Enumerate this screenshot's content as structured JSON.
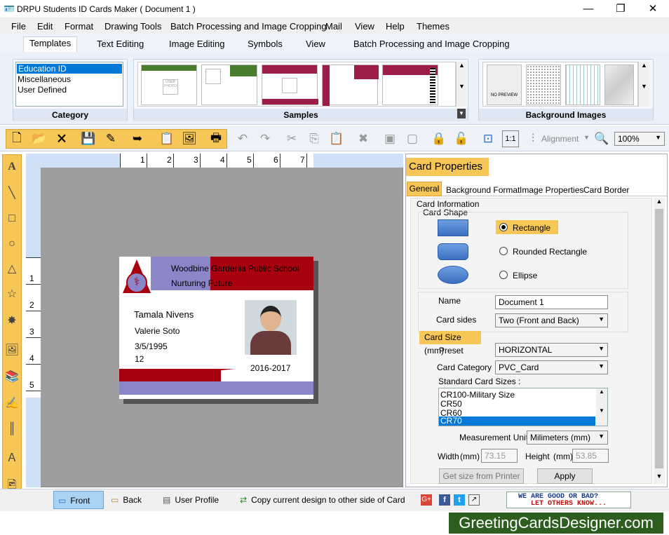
{
  "window": {
    "title": "DRPU Students ID Cards Maker ( Document 1 )"
  },
  "menu": [
    "File",
    "Edit",
    "Format",
    "Drawing Tools",
    "Batch Processing and Image Cropping",
    "Mail",
    "View",
    "Help",
    "Themes"
  ],
  "ribbon_tabs": [
    "Templates",
    "Text Editing",
    "Image Editing",
    "Symbols",
    "View",
    "Batch Processing and Image Cropping"
  ],
  "category": {
    "label": "Category",
    "items": [
      "Education ID",
      "Miscellaneous",
      "User Defined"
    ],
    "selected": "Education ID"
  },
  "samples": {
    "label": "Samples"
  },
  "backgrounds": {
    "label": "Background Images",
    "no_preview": "NO PREVIEW"
  },
  "toolbar": {
    "alignment": "Alignment",
    "zoom": "100%"
  },
  "ruler": {
    "h": [
      "1",
      "2",
      "3",
      "4",
      "5",
      "6",
      "7"
    ],
    "v": [
      "1",
      "2",
      "3",
      "4",
      "5"
    ]
  },
  "card": {
    "school": "Woodbine Gardenia Public School",
    "motto": "Nurturing Future",
    "name1": "Tamala Nivens",
    "name2": "Valerie Soto",
    "dob": "3/5/1995",
    "grade": "12",
    "session": "2016-2017",
    "colors": {
      "maroon": "#a8000f",
      "lavender": "#8a86c8"
    }
  },
  "props": {
    "title": "Card Properties",
    "tabs": [
      "General",
      "Background Format",
      "Image Properties",
      "Card Border"
    ],
    "card_information": "Card Information",
    "card_shape": "Card Shape",
    "shapes": [
      "Rectangle",
      "Rounded Rectangle",
      "Ellipse"
    ],
    "selected_shape": "Rectangle",
    "name_label": "Name",
    "name_value": "Document 1",
    "sides_label": "Card sides",
    "sides_value": "Two (Front and Back)",
    "size_header": "Card Size (mm)",
    "preset_label": "Preset",
    "preset_value": "HORIZONTAL",
    "category_label": "Card Category",
    "category_value": "PVC_Card",
    "std_label": "Standard Card Sizes :",
    "std_sizes": [
      "CR100-Military Size",
      "CR50",
      "CR60",
      "CR70"
    ],
    "std_selected": "CR70",
    "unit_label": "Measurement Unit :",
    "unit_value": "Milimeters (mm)",
    "width_label": "Width",
    "width_unit": "(mm)",
    "width_value": "73.15",
    "height_label": "Height",
    "height_unit": "(mm)",
    "height_value": "53.85",
    "get_size": "Get size from Printer",
    "apply": "Apply"
  },
  "status": {
    "front": "Front",
    "back": "Back",
    "user_profile": "User Profile",
    "copy": "Copy current design to other side of Card",
    "feedback1": "WE ARE GOOD OR BAD?",
    "feedback2": "LET OTHERS KNOW..."
  },
  "brand": "GreetingCardsDesigner.com"
}
